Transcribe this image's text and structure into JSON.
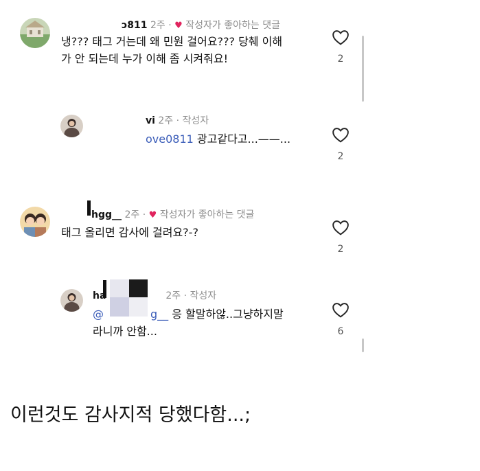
{
  "comments": [
    {
      "username": "ɔ811",
      "time": "2주",
      "creator_liked": "작성자가 좋아하는 댓글",
      "text_line1": "냉??? 태그 거는데 왜 민원 걸어요??? 당췌 이해",
      "text_line2": "가 안 되는데 누가 이해 좀 시켜줘요!",
      "likes": "2",
      "replies": [
        {
          "username": "vi",
          "time": "2주",
          "author_label": "작성자",
          "mention": "ove0811",
          "text": "광고같다고...——...",
          "likes": "2"
        }
      ]
    },
    {
      "username": "hgg__",
      "time": "2주",
      "creator_liked": "작성자가 좋아하는 댓글",
      "text_line1": "태그 올리면 감사에 걸려요?-?",
      "likes": "2",
      "replies": [
        {
          "username": "ha",
          "time": "2주",
          "author_label": "작성자",
          "mention": "@",
          "mention_tail": "g__",
          "text": "응 할말하않..그냥하지말",
          "text_line2": "라니까 안함...",
          "likes": "6"
        }
      ]
    }
  ],
  "separator": "·",
  "caption": "이런것도 감사지적 당했다함...;",
  "colors": {
    "heart_red": "#e0245e",
    "mention_blue": "#3a5cb8",
    "meta_gray": "#8e8e8e"
  },
  "icons": {
    "like": "heart-outline-icon",
    "creator_like": "heart-filled-icon"
  }
}
